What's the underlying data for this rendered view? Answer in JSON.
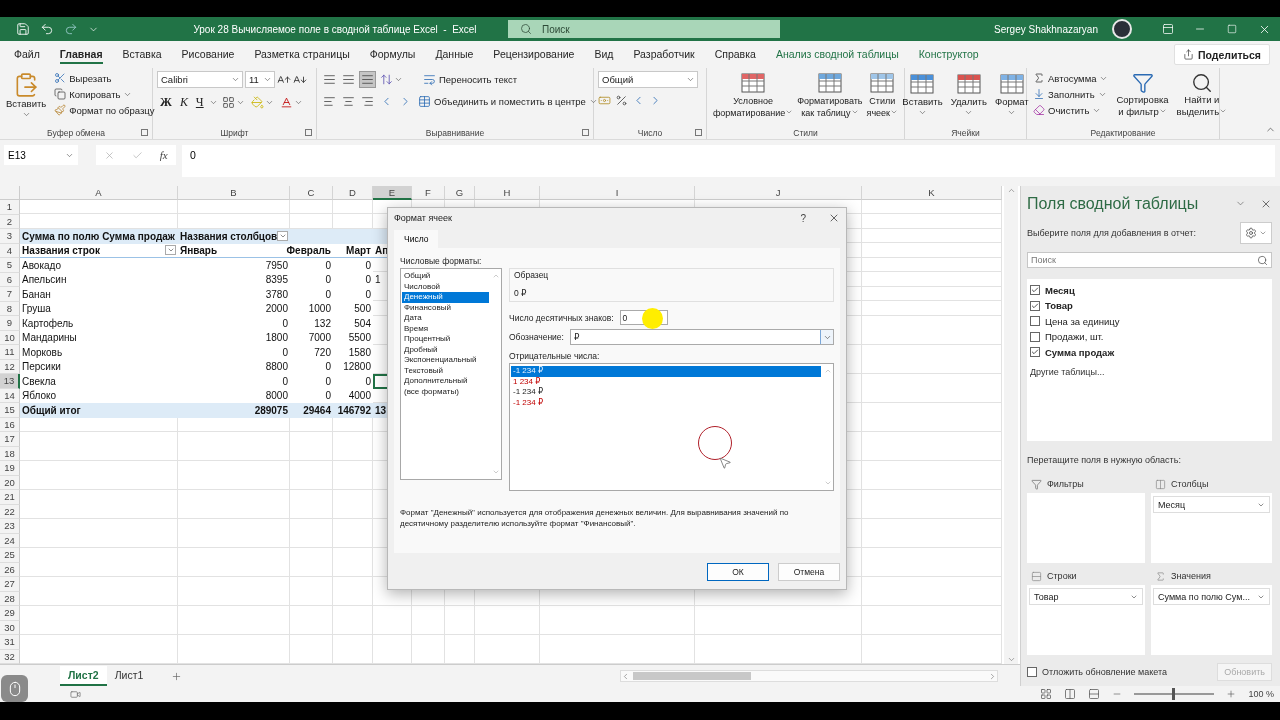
{
  "title_bar": {
    "title": "Урок 28 Вычисляемое поле в сводной таблице Excel  -  Excel",
    "search_placeholder": "Поиск",
    "user": "Sergey Shakhnazaryan"
  },
  "ribbon_tabs": [
    {
      "label": "Файл",
      "selected": false,
      "contextual": false
    },
    {
      "label": "Главная",
      "selected": true,
      "contextual": false
    },
    {
      "label": "Вставка",
      "selected": false,
      "contextual": false
    },
    {
      "label": "Рисование",
      "selected": false,
      "contextual": false
    },
    {
      "label": "Разметка страницы",
      "selected": false,
      "contextual": false
    },
    {
      "label": "Формулы",
      "selected": false,
      "contextual": false
    },
    {
      "label": "Данные",
      "selected": false,
      "contextual": false
    },
    {
      "label": "Рецензирование",
      "selected": false,
      "contextual": false
    },
    {
      "label": "Вид",
      "selected": false,
      "contextual": false
    },
    {
      "label": "Разработчик",
      "selected": false,
      "contextual": false
    },
    {
      "label": "Справка",
      "selected": false,
      "contextual": false
    },
    {
      "label": "Анализ сводной таблицы",
      "selected": false,
      "contextual": true
    },
    {
      "label": "Конструктор",
      "selected": false,
      "contextual": true
    }
  ],
  "share_button": "Поделиться",
  "ribbon": {
    "clipboard": {
      "paste": "Вставить",
      "cut": "Вырезать",
      "copy": "Копировать",
      "format_painter": "Формат по образцу",
      "group": "Буфер обмена"
    },
    "font": {
      "name": "Calibri",
      "size": "11",
      "bold": "Ж",
      "italic": "К",
      "underline": "Ч",
      "group": "Шрифт"
    },
    "alignment": {
      "vertical_buttons": [
        {
          "selected": false
        },
        {
          "selected": false
        },
        {
          "selected": true
        }
      ],
      "wrap": "Переносить текст",
      "merge": "Объединить и поместить в центре",
      "group": "Выравнивание"
    },
    "number": {
      "format": "Общий",
      "group": "Число"
    },
    "styles": {
      "buttons": [
        {
          "kind": "conditional",
          "lines": [
            "Условное",
            "форматирование"
          ]
        },
        {
          "kind": "table",
          "lines": [
            "Форматировать",
            "как таблицу"
          ]
        },
        {
          "kind": "cell",
          "lines": [
            "Стили",
            "ячеек"
          ]
        }
      ],
      "group": "Стили"
    },
    "cells": {
      "buttons": [
        {
          "kind": "insert",
          "label": "Вставить"
        },
        {
          "kind": "delete",
          "label": "Удалить"
        },
        {
          "kind": "format",
          "label": "Формат"
        }
      ],
      "group": "Ячейки"
    },
    "editing": {
      "autosum": "Автосумма",
      "fill": "Заполнить",
      "clear": "Очистить",
      "sort": [
        "Сортировка",
        "и фильтр"
      ],
      "find": [
        "Найти и",
        "выделить"
      ],
      "group": "Редактирование"
    }
  },
  "formula_bar": {
    "name_box": "E13",
    "fx": "fx",
    "value": "0"
  },
  "sheet": {
    "columns": [
      {
        "label": "A",
        "selected": false
      },
      {
        "label": "B",
        "selected": false
      },
      {
        "label": "C",
        "selected": false
      },
      {
        "label": "D",
        "selected": false
      },
      {
        "label": "E",
        "selected": true
      },
      {
        "label": "F",
        "selected": false
      },
      {
        "label": "G",
        "selected": false
      },
      {
        "label": "H",
        "selected": false
      },
      {
        "label": "I",
        "selected": false
      },
      {
        "label": "J",
        "selected": false
      },
      {
        "label": "K",
        "selected": false
      }
    ],
    "rows": [
      {
        "number": "1",
        "kind": "blank",
        "selected": false
      },
      {
        "number": "2",
        "kind": "blank",
        "selected": false
      },
      {
        "number": "3",
        "kind": "header",
        "selected": false,
        "cells": [
          {
            "text": "Сумма по полю Сумма продаж",
            "filter": false
          },
          {
            "text": "Названия столбцов",
            "filter": true
          }
        ]
      },
      {
        "number": "4",
        "kind": "header",
        "selected": false,
        "cells": [
          {
            "text": "Названия строк",
            "filter": true
          },
          {
            "text": "Январь",
            "filter": false
          },
          {
            "text": "Февраль",
            "filter": false
          },
          {
            "text": "Март",
            "filter": false
          },
          {
            "text": "Ап",
            "filter": false
          }
        ]
      },
      {
        "number": "5",
        "kind": "data",
        "selected": false,
        "cells": [
          "Авокадо",
          "7950",
          "0",
          "0"
        ]
      },
      {
        "number": "6",
        "kind": "data",
        "selected": false,
        "cells": [
          "Апельсин",
          "8395",
          "0",
          "0",
          "1"
        ]
      },
      {
        "number": "7",
        "kind": "data",
        "selected": false,
        "cells": [
          "Банан",
          "3780",
          "0",
          "0"
        ]
      },
      {
        "number": "8",
        "kind": "data",
        "selected": false,
        "cells": [
          "Груша",
          "2000",
          "1000",
          "500"
        ]
      },
      {
        "number": "9",
        "kind": "data",
        "selected": false,
        "cells": [
          "Картофель",
          "0",
          "132",
          "504"
        ]
      },
      {
        "number": "10",
        "kind": "data",
        "selected": false,
        "cells": [
          "Мандарины",
          "1800",
          "7000",
          "5500"
        ]
      },
      {
        "number": "11",
        "kind": "data",
        "selected": false,
        "cells": [
          "Морковь",
          "0",
          "720",
          "1580"
        ]
      },
      {
        "number": "12",
        "kind": "data",
        "selected": false,
        "cells": [
          "Персики",
          "8800",
          "0",
          "12800"
        ]
      },
      {
        "number": "13",
        "kind": "data",
        "selected": true,
        "cells": [
          "Свекла",
          "0",
          "0",
          "0"
        ]
      },
      {
        "number": "14",
        "kind": "data",
        "selected": false,
        "cells": [
          "Яблоко",
          "8000",
          "0",
          "4000"
        ]
      },
      {
        "number": "15",
        "kind": "total",
        "selected": false,
        "cells": [
          "Общий итог",
          "289075",
          "29464",
          "146792",
          "13"
        ]
      },
      {
        "number": "16",
        "kind": "blank",
        "selected": false
      },
      {
        "number": "17",
        "kind": "blank",
        "selected": false
      },
      {
        "number": "18",
        "kind": "blank",
        "selected": false
      },
      {
        "number": "19",
        "kind": "blank",
        "selected": false
      },
      {
        "number": "20",
        "kind": "blank",
        "selected": false
      },
      {
        "number": "21",
        "kind": "blank",
        "selected": false
      },
      {
        "number": "22",
        "kind": "blank",
        "selected": false
      },
      {
        "number": "23",
        "kind": "blank",
        "selected": false
      },
      {
        "number": "24",
        "kind": "blank",
        "selected": false
      },
      {
        "number": "25",
        "kind": "blank",
        "selected": false
      },
      {
        "number": "26",
        "kind": "blank",
        "selected": false
      },
      {
        "number": "27",
        "kind": "blank",
        "selected": false
      },
      {
        "number": "28",
        "kind": "blank",
        "selected": false
      },
      {
        "number": "29",
        "kind": "blank",
        "selected": false
      },
      {
        "number": "30",
        "kind": "blank",
        "selected": false
      },
      {
        "number": "31",
        "kind": "blank",
        "selected": false
      },
      {
        "number": "32",
        "kind": "blank",
        "selected": false
      }
    ]
  },
  "sheet_tabs": [
    {
      "label": "Лист2",
      "selected": true
    },
    {
      "label": "Лист1",
      "selected": false
    }
  ],
  "dialog": {
    "title": "Формат ячеек",
    "help": "?",
    "tabs": [
      {
        "label": "Число",
        "selected": true
      }
    ],
    "formats_label": "Числовые форматы:",
    "formats": [
      {
        "label": "Общий",
        "selected": false
      },
      {
        "label": "Числовой",
        "selected": false
      },
      {
        "label": "Денежный",
        "selected": true
      },
      {
        "label": "Финансовый",
        "selected": false
      },
      {
        "label": "Дата",
        "selected": false
      },
      {
        "label": "Время",
        "selected": false
      },
      {
        "label": "Процентный",
        "selected": false
      },
      {
        "label": "Дробный",
        "selected": false
      },
      {
        "label": "Экспоненциальный",
        "selected": false
      },
      {
        "label": "Текстовый",
        "selected": false
      },
      {
        "label": "Дополнительный",
        "selected": false
      },
      {
        "label": "(все форматы)",
        "selected": false
      }
    ],
    "sample_label": "Образец",
    "sample": "0 ₽",
    "decimals_label": "Число десятичных знаков:",
    "decimals": "0",
    "symbol_label": "Обозначение:",
    "symbol": "₽",
    "negative_label": "Отрицательные числа:",
    "negative": [
      {
        "label": "-1 234 ₽",
        "red": false,
        "selected": true
      },
      {
        "label": "1 234 ₽",
        "red": true,
        "selected": false
      },
      {
        "label": "-1 234 ₽",
        "red": false,
        "selected": false
      },
      {
        "label": "-1 234 ₽",
        "red": true,
        "selected": false
      }
    ],
    "description": "Формат \"Денежный\" используется для отображения денежных величин. Для выравнивания значений по десятичному разделителю используйте формат \"Финансовый\".",
    "ok": "ОК",
    "cancel": "Отмена"
  },
  "pivot_pane": {
    "title": "Поля сводной таблицы",
    "choose_label": "Выберите поля для добавления в отчет:",
    "search_placeholder": "Поиск",
    "fields": [
      {
        "label": "Месяц",
        "checked": true
      },
      {
        "label": "Товар",
        "checked": true
      },
      {
        "label": "Цена за единицу",
        "checked": false
      },
      {
        "label": "Продажи, шт.",
        "checked": false
      },
      {
        "label": "Сумма продаж",
        "checked": true
      }
    ],
    "more_tables": "Другие таблицы...",
    "drag_label": "Перетащите поля в нужную область:",
    "areas": [
      {
        "kind": "filters",
        "label": "Фильтры"
      },
      {
        "kind": "columns",
        "label": "Столбцы",
        "items": [
          "Месяц"
        ]
      },
      {
        "kind": "rows",
        "label": "Строки",
        "items": [
          "Товар"
        ]
      },
      {
        "kind": "values",
        "label": "Значения",
        "items": [
          "Сумма по полю Сум..."
        ]
      }
    ],
    "defer_label": "Отложить обновление макета",
    "defer_checked": false,
    "update_button": "Обновить",
    "update_disabled": true
  },
  "status_bar": {
    "zoom": "100 %",
    "zoom_slider": {
      "level": 0.5
    }
  }
}
